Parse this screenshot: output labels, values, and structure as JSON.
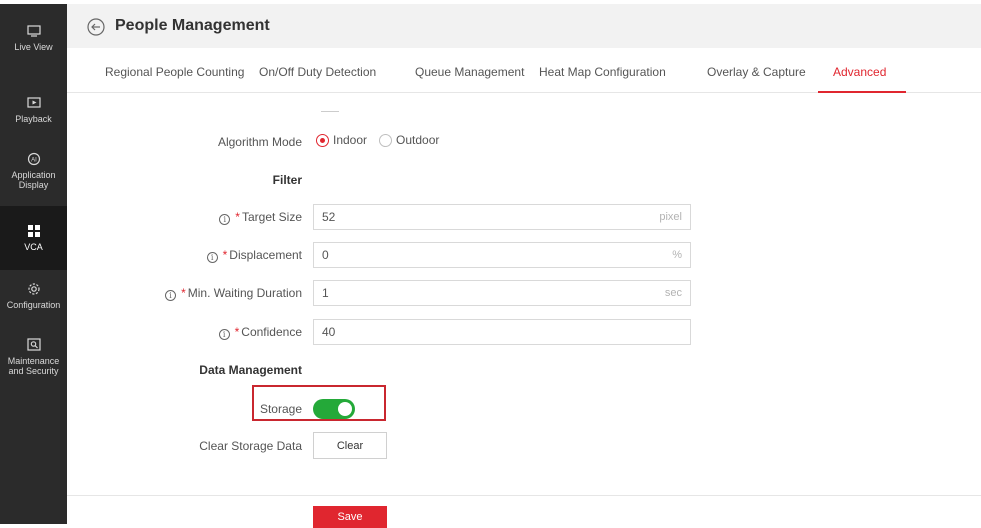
{
  "sidebar": {
    "items": [
      {
        "label": "Live View",
        "icon": "monitor-icon"
      },
      {
        "label": "Playback",
        "icon": "play-icon"
      },
      {
        "label": "Application Display",
        "icon": "ai-icon"
      },
      {
        "label": "VCA",
        "icon": "grid-icon",
        "active": true
      },
      {
        "label": "Configuration",
        "icon": "gear-icon"
      },
      {
        "label": "Maintenance and Security",
        "icon": "tool-icon"
      }
    ]
  },
  "header": {
    "title": "People Management",
    "back_icon": "back-arrow-icon"
  },
  "tabs": [
    {
      "label": "Regional People Counting"
    },
    {
      "label": "On/Off Duty Detection"
    },
    {
      "label": "Queue Management"
    },
    {
      "label": "Heat Map Configuration"
    },
    {
      "label": "Overlay & Capture"
    },
    {
      "label": "Advanced",
      "active": true
    }
  ],
  "form": {
    "algorithm_mode": {
      "label": "Algorithm Mode",
      "options": [
        "Indoor",
        "Outdoor"
      ],
      "selected": "Indoor"
    },
    "filter_title": "Filter",
    "target_size": {
      "label": "Target Size",
      "value": "52",
      "unit": "pixel"
    },
    "displacement": {
      "label": "Displacement",
      "value": "0",
      "unit": "%"
    },
    "min_waiting": {
      "label": "Min. Waiting Duration",
      "value": "1",
      "unit": "sec"
    },
    "confidence": {
      "label": "Confidence",
      "value": "40"
    },
    "data_mgmt_title": "Data Management",
    "storage": {
      "label": "Storage",
      "enabled": true
    },
    "clear_storage": {
      "label": "Clear Storage Data",
      "button": "Clear"
    },
    "save": "Save",
    "info_glyph": "i",
    "required_mark": "*"
  },
  "colors": {
    "accent": "#e0262f",
    "toggle_on": "#24a939",
    "sidebar": "#2b2b2b",
    "highlight_box": "#c9272f"
  }
}
